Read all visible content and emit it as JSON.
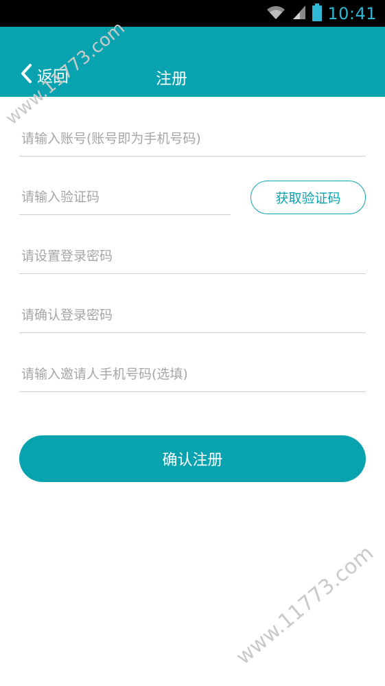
{
  "status_bar": {
    "time": "10:41",
    "icons": [
      "wifi-icon",
      "signal-icon",
      "battery-icon"
    ]
  },
  "header": {
    "back_label": "返回",
    "title": "注册"
  },
  "form": {
    "account_placeholder": "请输入账号(账号即为手机号码)",
    "code_placeholder": "请输入验证码",
    "get_code_label": "获取验证码",
    "password_placeholder": "请设置登录密码",
    "confirm_password_placeholder": "请确认登录密码",
    "inviter_placeholder": "请输入邀请人手机号码(选填)",
    "submit_label": "确认注册"
  },
  "watermark": {
    "text": "www.11773.com"
  },
  "colors": {
    "accent": "#09a3af",
    "status_bar": "#000000",
    "time": "#2fb7d3",
    "placeholder": "#a6a6a6",
    "divider": "#cfcfcf"
  }
}
